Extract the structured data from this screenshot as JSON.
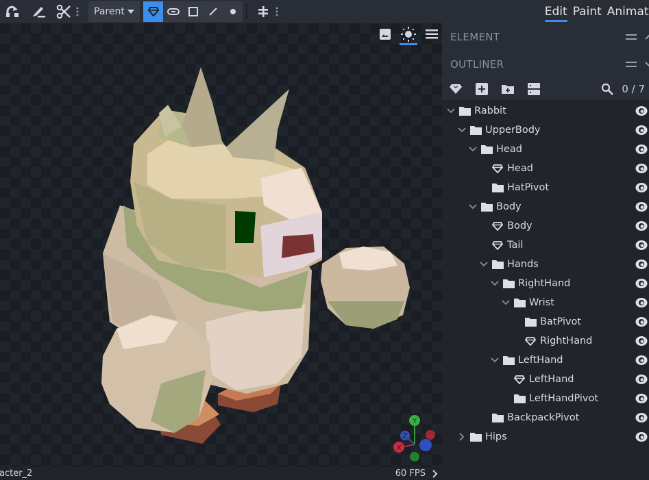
{
  "toolbar": {
    "left_tools": [
      {
        "icon": "pivot-rotate-icon"
      },
      {
        "icon": "brush-icon"
      },
      {
        "icon": "scissors-icon"
      }
    ],
    "parent_dropdown": {
      "value": "Parent"
    },
    "element_tools": [
      {
        "icon": "mesh-gem-icon",
        "active": true
      },
      {
        "icon": "link-icon",
        "active": false
      },
      {
        "icon": "square-icon",
        "active": false
      },
      {
        "icon": "line-icon",
        "active": false
      },
      {
        "icon": "dot-icon",
        "active": false
      }
    ],
    "extra_tool": {
      "icon": "mirror-axis-icon"
    }
  },
  "mode_tabs": [
    {
      "label": "Edit",
      "active": true
    },
    {
      "label": "Paint",
      "active": false
    },
    {
      "label": "Animate",
      "active": false
    }
  ],
  "viewport": {
    "tools": [
      {
        "icon": "image-icon",
        "active": false
      },
      {
        "icon": "sun-icon",
        "active": true
      },
      {
        "icon": "menu-icon",
        "active": false
      }
    ],
    "gizmo": {
      "x": "X",
      "y": "Y",
      "z": "Z"
    },
    "status_left": "acter_2",
    "status_fps": "60 FPS"
  },
  "panels": {
    "element": {
      "title": "ELEMENT"
    },
    "outliner": {
      "title": "OUTLINER",
      "count": "0 / 7",
      "tools": [
        "add-mesh-icon",
        "add-cube-icon",
        "add-group-icon",
        "collapse-all-icon"
      ]
    }
  },
  "outliner_tree": [
    {
      "label": "Rabbit",
      "type": "group",
      "depth": 0,
      "expanded": true
    },
    {
      "label": "UpperBody",
      "type": "group",
      "depth": 1,
      "expanded": true
    },
    {
      "label": "Head",
      "type": "group",
      "depth": 2,
      "expanded": true
    },
    {
      "label": "Head",
      "type": "mesh",
      "depth": 3
    },
    {
      "label": "HatPivot",
      "type": "group",
      "depth": 3,
      "expanded": null
    },
    {
      "label": "Body",
      "type": "group",
      "depth": 2,
      "expanded": true
    },
    {
      "label": "Body",
      "type": "mesh",
      "depth": 3
    },
    {
      "label": "Tail",
      "type": "mesh",
      "depth": 3
    },
    {
      "label": "Hands",
      "type": "group",
      "depth": 3,
      "expanded": true
    },
    {
      "label": "RightHand",
      "type": "group",
      "depth": 4,
      "expanded": true
    },
    {
      "label": "Wrist",
      "type": "group",
      "depth": 5,
      "expanded": true
    },
    {
      "label": "BatPivot",
      "type": "group",
      "depth": 6,
      "expanded": null
    },
    {
      "label": "RightHand",
      "type": "mesh",
      "depth": 6
    },
    {
      "label": "LeftHand",
      "type": "group",
      "depth": 4,
      "expanded": true
    },
    {
      "label": "LeftHand",
      "type": "mesh",
      "depth": 5
    },
    {
      "label": "LeftHandPivot",
      "type": "group",
      "depth": 5,
      "expanded": null
    },
    {
      "label": "BackpackPivot",
      "type": "group",
      "depth": 3,
      "expanded": null
    },
    {
      "label": "Hips",
      "type": "group",
      "depth": 1,
      "expanded": false
    }
  ]
}
